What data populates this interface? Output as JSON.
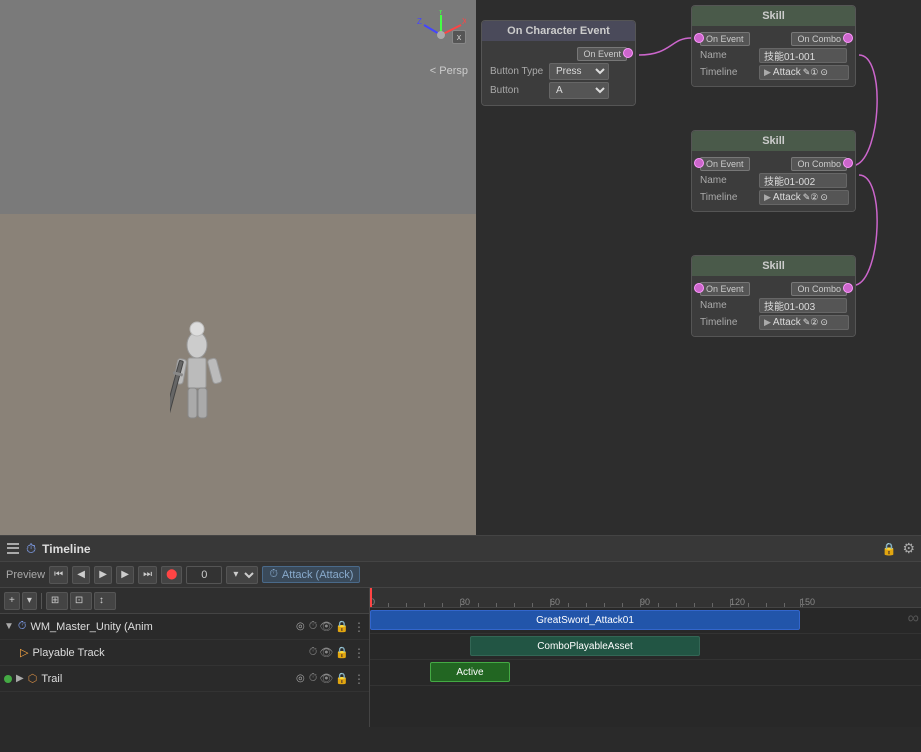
{
  "viewport": {
    "persp_label": "< Persp",
    "close_label": "x"
  },
  "node_graph": {
    "char_event_node": {
      "title": "On Character Event",
      "on_event_label": "On Event",
      "button_type_label": "Button Type",
      "button_type_value": "Press",
      "button_label": "Button",
      "button_value": "A"
    },
    "skill1_node": {
      "title": "Skill",
      "on_event_label": "On Event",
      "on_combo_label": "On Combo",
      "name_label": "Name",
      "name_value": "技能01-001",
      "timeline_label": "Timeline",
      "timeline_value": "Attack"
    },
    "skill2_node": {
      "title": "Skill",
      "on_event_label": "On Event",
      "on_combo_label": "On Combo",
      "name_label": "Name",
      "name_value": "技能01-002",
      "timeline_label": "Timeline",
      "timeline_value": "Attack"
    },
    "skill3_node": {
      "title": "Skill",
      "on_event_label": "On Event",
      "on_combo_label": "On Combo",
      "name_label": "Name",
      "name_value": "技能01-003",
      "timeline_label": "Timeline",
      "timeline_value": "Attack"
    }
  },
  "timeline": {
    "title": "Timeline",
    "preview_label": "Preview",
    "frame_value": "0",
    "attack_label": "Attack (Attack)",
    "ruler_marks": [
      "0",
      "30",
      "60",
      "90",
      "120",
      "150"
    ],
    "tracks": [
      {
        "name": "WM_Master_Unity (Anim",
        "type": "animation",
        "has_checkbox": true,
        "clip_label": "GreatSword_Attack01",
        "clip_type": "blue"
      },
      {
        "name": "Playable Track",
        "type": "playable",
        "has_checkbox": false,
        "clip_label": "ComboPlayableAsset",
        "clip_type": "teal"
      },
      {
        "name": "Trail",
        "type": "trail",
        "has_checkbox": true,
        "clip_label": "Active",
        "clip_type": "active"
      }
    ],
    "toolbar": {
      "add_label": "+",
      "add_dropdown": "▾",
      "step_back_label": "◀◀",
      "prev_frame_label": "◀",
      "play_label": "▶",
      "next_frame_label": "▶",
      "step_fwd_label": "▶▶",
      "record_label": "⬤",
      "tracks_goto_start": "⏮",
      "tracks_goto_end": "⏭",
      "tracks_add": "+",
      "tracks_snap": "⊞",
      "tracks_ripple": "⊡",
      "tracks_cursor": "↕"
    }
  },
  "colors": {
    "accent_purple": "#cc66cc",
    "accent_blue": "#2255aa",
    "accent_teal": "#225544",
    "accent_green": "#226622",
    "node_event_header": "#4a4a5a",
    "node_skill_header": "#4a5a4a"
  }
}
